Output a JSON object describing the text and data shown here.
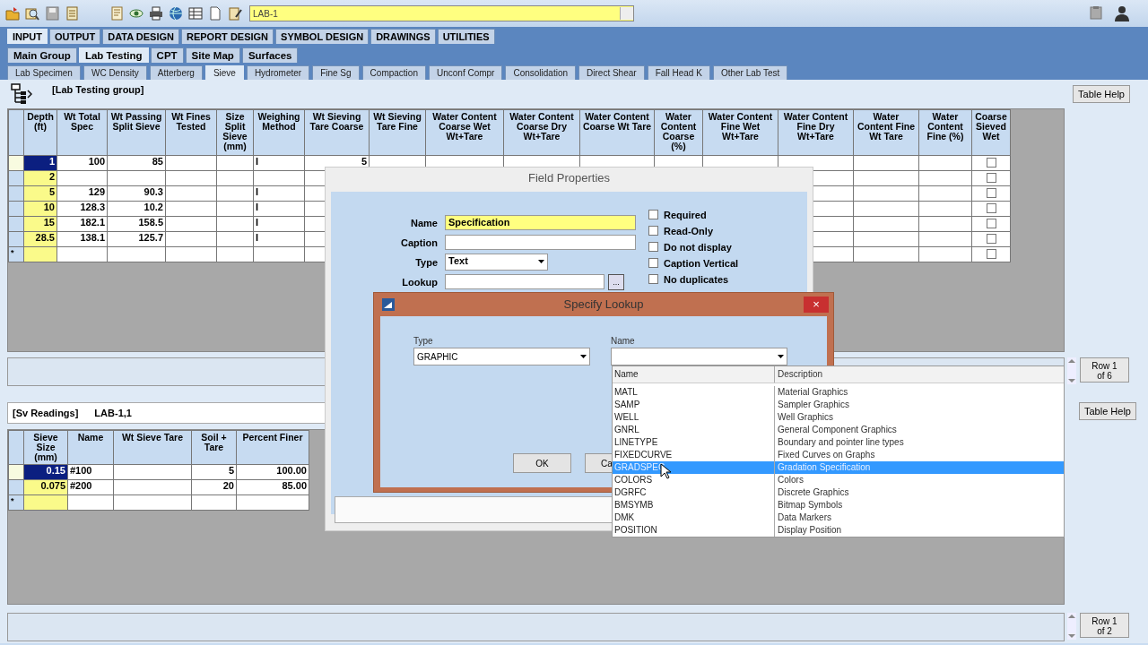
{
  "toolbar": {
    "project_field": {
      "value": "LAB-1"
    }
  },
  "main_tabs": [
    {
      "label": "INPUT",
      "selected": true
    },
    {
      "label": "OUTPUT",
      "selected": false
    },
    {
      "label": "DATA DESIGN",
      "selected": false
    },
    {
      "label": "REPORT DESIGN",
      "selected": false
    },
    {
      "label": "SYMBOL DESIGN",
      "selected": false
    },
    {
      "label": "DRAWINGS",
      "selected": false
    },
    {
      "label": "UTILITIES",
      "selected": false
    }
  ],
  "group_tabs": [
    {
      "label": "Main Group",
      "selected": false
    },
    {
      "label": "Lab Testing",
      "selected": true
    },
    {
      "label": "CPT",
      "selected": false
    },
    {
      "label": "Site Map",
      "selected": false
    },
    {
      "label": "Surfaces",
      "selected": false
    }
  ],
  "table_tabs": [
    {
      "label": "Lab Specimen",
      "selected": false
    },
    {
      "label": "WC Density",
      "selected": false
    },
    {
      "label": "Atterberg",
      "selected": false
    },
    {
      "label": "Sieve",
      "selected": true
    },
    {
      "label": "Hydrometer",
      "selected": false
    },
    {
      "label": "Fine Sg",
      "selected": false
    },
    {
      "label": "Compaction",
      "selected": false
    },
    {
      "label": "Unconf Compr",
      "selected": false
    },
    {
      "label": "Consolidation",
      "selected": false
    },
    {
      "label": "Direct Shear",
      "selected": false
    },
    {
      "label": "Fall Head K",
      "selected": false
    },
    {
      "label": "Other Lab Test",
      "selected": false
    }
  ],
  "group_header": {
    "title": "[Lab Testing group]",
    "help_button": "Table Help"
  },
  "main_table": {
    "columns": [
      "Depth (ft)",
      "Wt Total Spec",
      "Wt Passing Split Sieve",
      "Wt Fines Tested",
      "Size Split Sieve (mm)",
      "Weighing Method",
      "Wt Sieving Tare Coarse",
      "Wt Sieving Tare Fine",
      "Water Content Coarse Wet Wt+Tare",
      "Water Content Coarse Dry Wt+Tare",
      "Water Content Coarse Wt Tare",
      "Water Content Coarse (%)",
      "Water Content Fine Wet Wt+Tare",
      "Water Content Fine Dry Wt+Tare",
      "Water Content Fine Wt Tare",
      "Water Content Fine (%)",
      "Coarse Sieved Wet"
    ],
    "rows": [
      {
        "selected": true,
        "cells": {
          "0": "1",
          "1": "100",
          "2": "85",
          "5": "I",
          "6": "5"
        },
        "sieved_wet": false
      },
      {
        "selected": false,
        "cells": {
          "0": "2"
        },
        "sieved_wet": false
      },
      {
        "selected": false,
        "cells": {
          "0": "5",
          "1": "129",
          "2": "90.3",
          "5": "I"
        },
        "sieved_wet": false
      },
      {
        "selected": false,
        "cells": {
          "0": "10",
          "1": "128.3",
          "2": "10.2",
          "5": "I"
        },
        "sieved_wet": false
      },
      {
        "selected": false,
        "cells": {
          "0": "15",
          "1": "182.1",
          "2": "158.5",
          "5": "I"
        },
        "sieved_wet": false
      },
      {
        "selected": false,
        "cells": {
          "0": "28.5",
          "1": "138.1",
          "2": "125.7",
          "5": "I"
        },
        "sieved_wet": false
      },
      {
        "selected": false,
        "marker": "*",
        "cells": {},
        "sieved_wet": false
      }
    ],
    "row_counter": "Row 1 of 6"
  },
  "sub_table": {
    "title": "[Sv Readings]",
    "record": "LAB-1,1",
    "help_button": "Table Help",
    "columns": [
      "Sieve Size (mm)",
      "Name",
      "Wt Sieve Tare",
      "Soil + Tare",
      "Percent Finer"
    ],
    "rows": [
      {
        "selected": true,
        "cells": {
          "0": "0.15",
          "1": "#100",
          "3": "5",
          "4": "100.00"
        }
      },
      {
        "selected": false,
        "cells": {
          "0": "0.075",
          "1": "#200",
          "3": "20",
          "4": "85.00"
        }
      },
      {
        "selected": false,
        "marker": "*",
        "cells": {}
      }
    ],
    "row_counter": "Row 1 of 2"
  },
  "field_properties": {
    "title": "Field Properties",
    "fields": [
      {
        "label": "Name",
        "kind": "text",
        "value": "Specification",
        "focused": true
      },
      {
        "label": "Caption",
        "kind": "text",
        "focused": false
      },
      {
        "label": "Type",
        "kind": "dropdown",
        "value": "Text",
        "focused": false
      },
      {
        "label": "Lookup",
        "kind": "lookup",
        "button": "...",
        "focused": false
      }
    ],
    "options": [
      {
        "label": "Required",
        "checked": false
      },
      {
        "label": "Read-Only",
        "checked": false
      },
      {
        "label": "Do not display",
        "checked": false
      },
      {
        "label": "Caption Vertical",
        "checked": false
      },
      {
        "label": "No duplicates",
        "checked": false
      }
    ]
  },
  "specify_lookup": {
    "title": "Specify Lookup",
    "close": "×",
    "type_field": {
      "label": "Type",
      "value": "GRAPHIC"
    },
    "name_field": {
      "label": "Name"
    },
    "buttons": [
      {
        "label": "OK"
      },
      {
        "label": "Ca"
      }
    ],
    "dropdown": {
      "columns": [
        "Name",
        "Description"
      ],
      "rows": [
        {
          "name": "MATL",
          "description": "Material Graphics",
          "selected": false
        },
        {
          "name": "SAMP",
          "description": "Sampler Graphics",
          "selected": false
        },
        {
          "name": "WELL",
          "description": "Well Graphics",
          "selected": false
        },
        {
          "name": "GNRL",
          "description": "General Component Graphics",
          "selected": false
        },
        {
          "name": "LINETYPE",
          "description": "Boundary and pointer line types",
          "selected": false
        },
        {
          "name": "FIXEDCURVE",
          "description": "Fixed Curves on Graphs",
          "selected": false
        },
        {
          "name": "GRADSPEC",
          "description": "Gradation Specification",
          "selected": true
        },
        {
          "name": "COLORS",
          "description": "Colors",
          "selected": false
        },
        {
          "name": "DGRFC",
          "description": "Discrete Graphics",
          "selected": false
        },
        {
          "name": "BMSYMB",
          "description": "Bitmap Symbols",
          "selected": false
        },
        {
          "name": "DMK",
          "description": "Data Markers",
          "selected": false
        },
        {
          "name": "POSITION",
          "description": "Display Position",
          "selected": false
        }
      ]
    }
  }
}
